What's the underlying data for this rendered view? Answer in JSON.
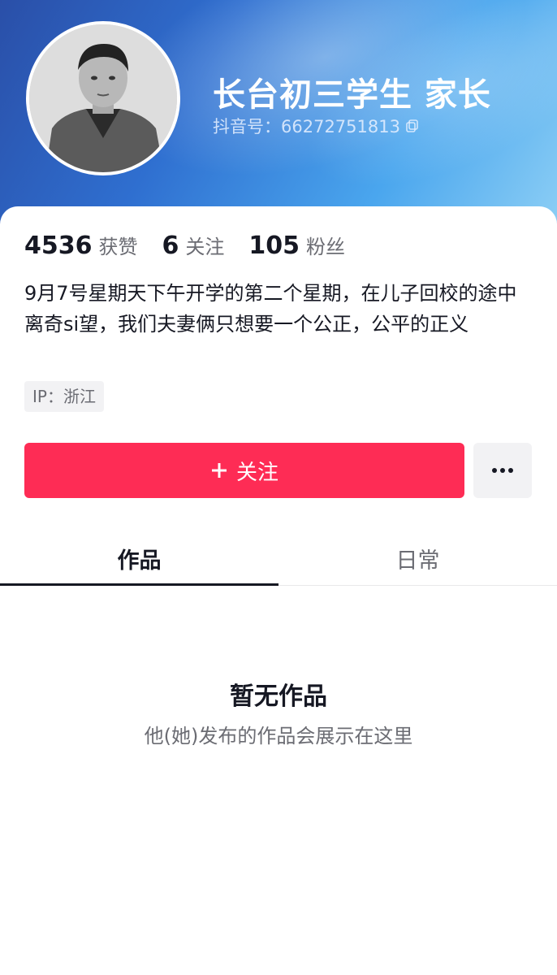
{
  "profile": {
    "nickname": "长台初三学生  家长",
    "douyin_id": "抖音号：66272751813",
    "avatar_icon": "profile-photo-icon",
    "copy_icon": "copy-icon"
  },
  "stats": [
    {
      "value": "4536",
      "label": "获赞"
    },
    {
      "value": "6",
      "label": "关注"
    },
    {
      "value": "105",
      "label": "粉丝"
    }
  ],
  "bio": "9月7号星期天下午开学的第二个星期，在儿子回校的途中离奇si望，我们夫妻俩只想要一个公正，公平的正义",
  "ip_location": "IP：浙江",
  "actions": {
    "follow_label": "关注",
    "follow_icon": "plus-icon",
    "more_icon": "more-dots-icon"
  },
  "tabs": [
    {
      "label": "作品",
      "active": true
    },
    {
      "label": "日常",
      "active": false
    }
  ],
  "empty_state": {
    "title": "暂无作品",
    "subtitle": "他(她)发布的作品会展示在这里"
  },
  "colors": {
    "accent": "#fe2c55",
    "text_primary": "#161823",
    "text_secondary": "#6b6c73",
    "banner_start": "#2a4fa8",
    "banner_end": "#8fd0f5"
  }
}
